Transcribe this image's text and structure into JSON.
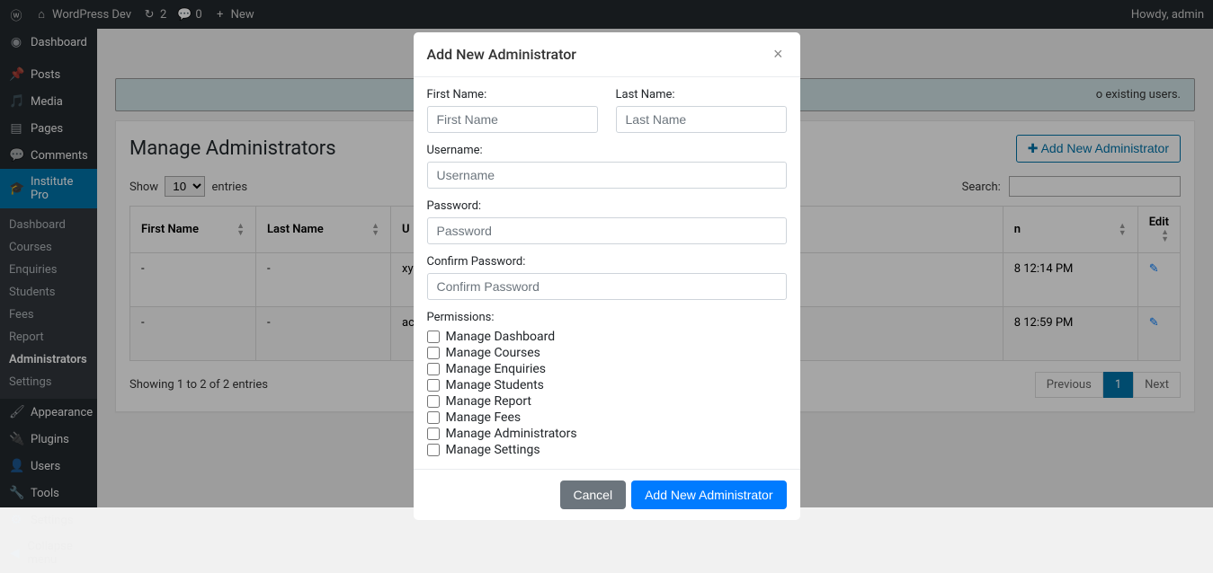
{
  "adminBar": {
    "siteName": "WordPress Dev",
    "updatesCount": "2",
    "commentsCount": "0",
    "newLabel": "New",
    "greeting": "Howdy, admin"
  },
  "sidebar": {
    "items": [
      {
        "label": "Dashboard",
        "icon": "⌂"
      },
      {
        "label": "Posts",
        "icon": "✎"
      },
      {
        "label": "Media",
        "icon": "🎵"
      },
      {
        "label": "Pages",
        "icon": "▤"
      },
      {
        "label": "Comments",
        "icon": "💬"
      },
      {
        "label": "Institute Pro",
        "icon": "🎓",
        "active": true
      },
      {
        "label": "Appearance",
        "icon": "🖌"
      },
      {
        "label": "Plugins",
        "icon": "🔌"
      },
      {
        "label": "Users",
        "icon": "👤"
      },
      {
        "label": "Tools",
        "icon": "🔧"
      },
      {
        "label": "Settings",
        "icon": "⚙"
      },
      {
        "label": "Collapse menu",
        "icon": "◀"
      }
    ],
    "submenu": [
      "Dashboard",
      "Courses",
      "Enquiries",
      "Students",
      "Fees",
      "Report",
      "Administrators",
      "Settings"
    ],
    "submenu_current": "Administrators"
  },
  "notice": "o existing users.",
  "page": {
    "title": "Manage Administrators",
    "addBtn": "Add New Administrator",
    "showLabel": "Show",
    "entriesLabel": "entries",
    "showValue": "10",
    "searchLabel": "Search:",
    "infoText": "Showing 1 to 2 of 2 entries",
    "prevLabel": "Previous",
    "nextLabel": "Next",
    "pageNum": "1",
    "columns": [
      "First Name",
      "Last Name",
      "U",
      "n",
      "Edit"
    ],
    "rows": [
      {
        "first": "-",
        "last": "-",
        "u": "xy",
        "n": "8 12:14 PM"
      },
      {
        "first": "-",
        "last": "-",
        "u": "ac",
        "n": "8 12:59 PM"
      }
    ]
  },
  "modal": {
    "title": "Add New Administrator",
    "firstNameLabel": "First Name:",
    "firstNamePh": "First Name",
    "lastNameLabel": "Last Name:",
    "lastNamePh": "Last Name",
    "usernameLabel": "Username:",
    "usernamePh": "Username",
    "passwordLabel": "Password:",
    "passwordPh": "Password",
    "confirmLabel": "Confirm Password:",
    "confirmPh": "Confirm Password",
    "permLabel": "Permissions:",
    "permissions": [
      "Manage Dashboard",
      "Manage Courses",
      "Manage Enquiries",
      "Manage Students",
      "Manage Report",
      "Manage Fees",
      "Manage Administrators",
      "Manage Settings"
    ],
    "cancelBtn": "Cancel",
    "submitBtn": "Add New Administrator"
  }
}
